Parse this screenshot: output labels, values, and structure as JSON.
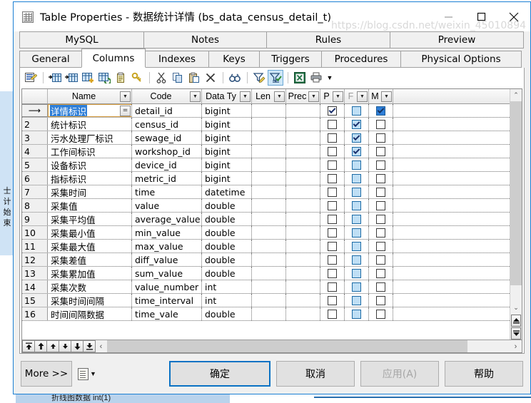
{
  "window": {
    "title": "Table Properties - 数据统计详情 (bs_data_census_detail_t)",
    "icon": "table-icon",
    "minimize": "–",
    "maximize": "□",
    "close": "✕"
  },
  "tabs": {
    "row1": [
      {
        "label": "MySQL",
        "active": false
      },
      {
        "label": "Notes",
        "active": false
      },
      {
        "label": "Rules",
        "active": false
      },
      {
        "label": "Preview",
        "active": false
      }
    ],
    "row2": [
      {
        "label": "General",
        "active": false
      },
      {
        "label": "Columns",
        "active": true
      },
      {
        "label": "Indexes",
        "active": false
      },
      {
        "label": "Keys",
        "active": false
      },
      {
        "label": "Triggers",
        "active": false
      },
      {
        "label": "Procedures",
        "active": false
      },
      {
        "label": "Physical Options",
        "active": false
      }
    ]
  },
  "toolbar": {
    "items": [
      {
        "name": "properties-icon",
        "selected": false
      },
      {
        "name": "insert-column-icon",
        "selected": false
      },
      {
        "name": "add-column-icon",
        "selected": false
      },
      {
        "name": "add-column-plus-icon",
        "selected": false
      },
      {
        "name": "duplicate-column-icon",
        "selected": false
      },
      {
        "name": "paste-column-icon",
        "selected": false
      },
      {
        "name": "primary-key-icon",
        "selected": false
      },
      {
        "name": "cut-icon",
        "selected": false
      },
      {
        "name": "copy-icon",
        "selected": false
      },
      {
        "name": "paste-icon",
        "selected": false
      },
      {
        "name": "delete-icon",
        "selected": false
      },
      {
        "name": "find-icon",
        "selected": false
      },
      {
        "name": "filter-edit-icon",
        "selected": false
      },
      {
        "name": "filter-apply-icon",
        "selected": true
      },
      {
        "name": "export-excel-icon",
        "selected": false
      },
      {
        "name": "print-icon",
        "selected": false
      }
    ],
    "dropdown_caret": "▼"
  },
  "grid": {
    "headers": [
      {
        "key": "row",
        "label": "",
        "dropdown": false,
        "dim": false
      },
      {
        "key": "name",
        "label": "Name",
        "dropdown": true,
        "dim": false
      },
      {
        "key": "code",
        "label": "Code",
        "dropdown": true,
        "dim": false
      },
      {
        "key": "type",
        "label": "Data Ty",
        "dropdown": true,
        "dim": false
      },
      {
        "key": "len",
        "label": "Len",
        "dropdown": true,
        "dim": false
      },
      {
        "key": "prec",
        "label": "Prec",
        "dropdown": true,
        "dim": false
      },
      {
        "key": "p",
        "label": "P",
        "dropdown": true,
        "dim": false
      },
      {
        "key": "f",
        "label": "F",
        "dropdown": true,
        "dim": true
      },
      {
        "key": "n",
        "label": "M",
        "dropdown": true,
        "dim": false
      }
    ],
    "editing": {
      "row": 1,
      "column": "name",
      "selected_text": "详情标识",
      "expand_label": "="
    },
    "rows": [
      {
        "num": "1",
        "current": true,
        "name": "详情标识",
        "code": "detail_id",
        "type": "bigint",
        "len": "",
        "prec": "",
        "p": "checked",
        "f": "blue",
        "n": "checked-blue"
      },
      {
        "num": "2",
        "current": false,
        "name": "统计标识",
        "code": "census_id",
        "type": "bigint",
        "len": "",
        "prec": "",
        "p": "empty",
        "f": "blue-checked",
        "n": "empty"
      },
      {
        "num": "3",
        "current": false,
        "name": "污水处理厂标识",
        "code": "sewage_id",
        "type": "bigint",
        "len": "",
        "prec": "",
        "p": "empty",
        "f": "blue-checked",
        "n": "empty"
      },
      {
        "num": "4",
        "current": false,
        "name": "工作间标识",
        "code": "workshop_id",
        "type": "bigint",
        "len": "",
        "prec": "",
        "p": "empty",
        "f": "blue-checked",
        "n": "empty"
      },
      {
        "num": "5",
        "current": false,
        "name": "设备标识",
        "code": "device_id",
        "type": "bigint",
        "len": "",
        "prec": "",
        "p": "empty",
        "f": "blue",
        "n": "empty"
      },
      {
        "num": "6",
        "current": false,
        "name": "指标标识",
        "code": "metric_id",
        "type": "bigint",
        "len": "",
        "prec": "",
        "p": "empty",
        "f": "blue",
        "n": "empty"
      },
      {
        "num": "7",
        "current": false,
        "name": "采集时间",
        "code": "time",
        "type": "datetime",
        "len": "",
        "prec": "",
        "p": "empty",
        "f": "blue",
        "n": "empty"
      },
      {
        "num": "8",
        "current": false,
        "name": "采集值",
        "code": "value",
        "type": "double",
        "len": "",
        "prec": "",
        "p": "empty",
        "f": "blue",
        "n": "empty"
      },
      {
        "num": "9",
        "current": false,
        "name": "采集平均值",
        "code": "average_value",
        "type": "double",
        "len": "",
        "prec": "",
        "p": "empty",
        "f": "blue",
        "n": "empty"
      },
      {
        "num": "10",
        "current": false,
        "name": "采集最小值",
        "code": "min_value",
        "type": "double",
        "len": "",
        "prec": "",
        "p": "empty",
        "f": "blue",
        "n": "empty"
      },
      {
        "num": "11",
        "current": false,
        "name": "采集最大值",
        "code": "max_value",
        "type": "double",
        "len": "",
        "prec": "",
        "p": "empty",
        "f": "blue",
        "n": "empty"
      },
      {
        "num": "12",
        "current": false,
        "name": "采集差值",
        "code": "diff_value",
        "type": "double",
        "len": "",
        "prec": "",
        "p": "empty",
        "f": "blue",
        "n": "empty"
      },
      {
        "num": "13",
        "current": false,
        "name": "采集累加值",
        "code": "sum_value",
        "type": "double",
        "len": "",
        "prec": "",
        "p": "empty",
        "f": "blue",
        "n": "empty"
      },
      {
        "num": "14",
        "current": false,
        "name": "采集次数",
        "code": "value_number",
        "type": "int",
        "len": "",
        "prec": "",
        "p": "empty",
        "f": "blue",
        "n": "empty"
      },
      {
        "num": "15",
        "current": false,
        "name": "采集时间间隔",
        "code": "time_interval",
        "type": "int",
        "len": "",
        "prec": "",
        "p": "empty",
        "f": "blue",
        "n": "empty"
      },
      {
        "num": "16",
        "current": false,
        "name": "时间间隔数据",
        "code": "time_vale",
        "type": "double",
        "len": "",
        "prec": "",
        "p": "empty",
        "f": "blue",
        "n": "empty"
      }
    ],
    "nav_buttons": [
      "first-record-button",
      "prev-page-button",
      "prev-record-button",
      "next-record-button",
      "next-page-button",
      "last-record-button"
    ],
    "vscroll": {
      "up": "⌃",
      "down": "⌄",
      "page_up": "▲",
      "page_down": "▼"
    },
    "hscroll": {
      "left": "‹",
      "right": "›"
    }
  },
  "footer": {
    "more_label": "More >>",
    "doc_caret": "▼",
    "ok_label": "确定",
    "cancel_label": "取消",
    "apply_label": "应用(A)",
    "help_label": "帮助"
  },
  "watermark": {
    "text": "https://blog.csdn.net/weixin_45010894"
  },
  "background": {
    "left_text": "士计始束",
    "bottom_text": "折线图数据  int(1)"
  },
  "colors": {
    "accent": "#0a72c4",
    "title_border": "#1a7fd4",
    "selection": "#2f7fd8",
    "checkbox_blue": "#bfdff5",
    "dialog_bg": "#f0f0f0"
  }
}
